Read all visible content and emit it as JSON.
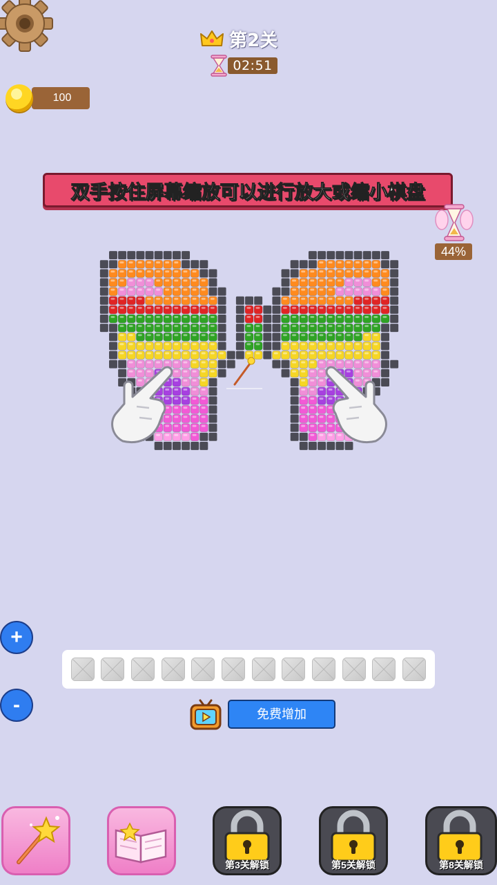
{
  "level": {
    "title": "第2关"
  },
  "timer": {
    "value": "02:51"
  },
  "coins": {
    "value": "100"
  },
  "hint": {
    "text": "双手按住屏幕缩放可以进行放大或缩小棋盘"
  },
  "progress": {
    "percent_label": "44%",
    "percent": 44
  },
  "zoom": {
    "in_label": "+",
    "out_label": "-"
  },
  "slots": {
    "count": 12,
    "filled": 0
  },
  "free_add": {
    "label": "免费增加"
  },
  "tools": [
    {
      "name": "magic-wand",
      "locked": false
    },
    {
      "name": "book",
      "locked": false
    },
    {
      "name": "locked-tool",
      "locked": true,
      "label": "第3关解锁"
    },
    {
      "name": "locked-tool",
      "locked": true,
      "label": "第5关解锁"
    },
    {
      "name": "locked-tool",
      "locked": true,
      "label": "第8关解锁"
    }
  ],
  "board": {
    "palette": {
      "K": "#4b4b55",
      "O": "#ff8a1e",
      "R": "#e02424",
      "G": "#2fa324",
      "Y": "#f6d625",
      "P": "#f08ed8",
      "V": "#a740e0",
      "M": "#f25ad6",
      "L": "#ff9ee6"
    },
    "rows": [
      "...KKKKKKKKK.............KKKKKKKKK...",
      "..KKOOOOOOOKKK.........KKKOOOOOOOKK..",
      "..KOOOOOOOOOOKK.......KKOOOOOOOOOOK..",
      "..KOOPPPOOOOOOK.......KOOOOOOPPPOOK..",
      "..KOPPPPPOOOOOKK.....KKOOOOOPPPPPOK..",
      "..KRRRROOOOOOOOK.KKK.KOOOOOOOORRRRK..",
      "..KRRRRRRRRRRRRK.KRRKKRRRRRRRRRRRRK..",
      "..KGGGGGGGGGGGGK.KRRKKGGGGGGGGGGGGK..",
      "..KKGGGGGGGGGGGK.KGGKKGGGGGGGGGGGKK..",
      "...KYYGGGGGGGGGK.KGGKKGGGGGGGGGYYK...",
      "...KYYYYYYYYYYYK.KGGKKYYYYYYYYYYYK...",
      "...KYYYYYYYYYYYYKKYYKYYYYYYYYYYYYK...",
      "...KKPPPPPPPYYYKK....KKYYYPPPPPPPKK..",
      "....KPPPVVPPPYYK......KYYPPPVVPPPK...",
      "....KKPPVVVPPYK........KYPPVVVPPKK...",
      ".....KKVVVVVPPK........KPPVVVVVKK....",
      "......KKVVVVMMK........KMMVVVVKK.....",
      "......KMMMMMMMK........KMMMMMMMK.....",
      ".....KMMMMMMMMK........KMMMMMMMMK....",
      ".....KKMMMMMMMK........KMMMMMMMKK....",
      "......KKLLLLMKK........KKMLLLLKK.....",
      "........KKKKKK..........KKKKKK......"
    ]
  }
}
